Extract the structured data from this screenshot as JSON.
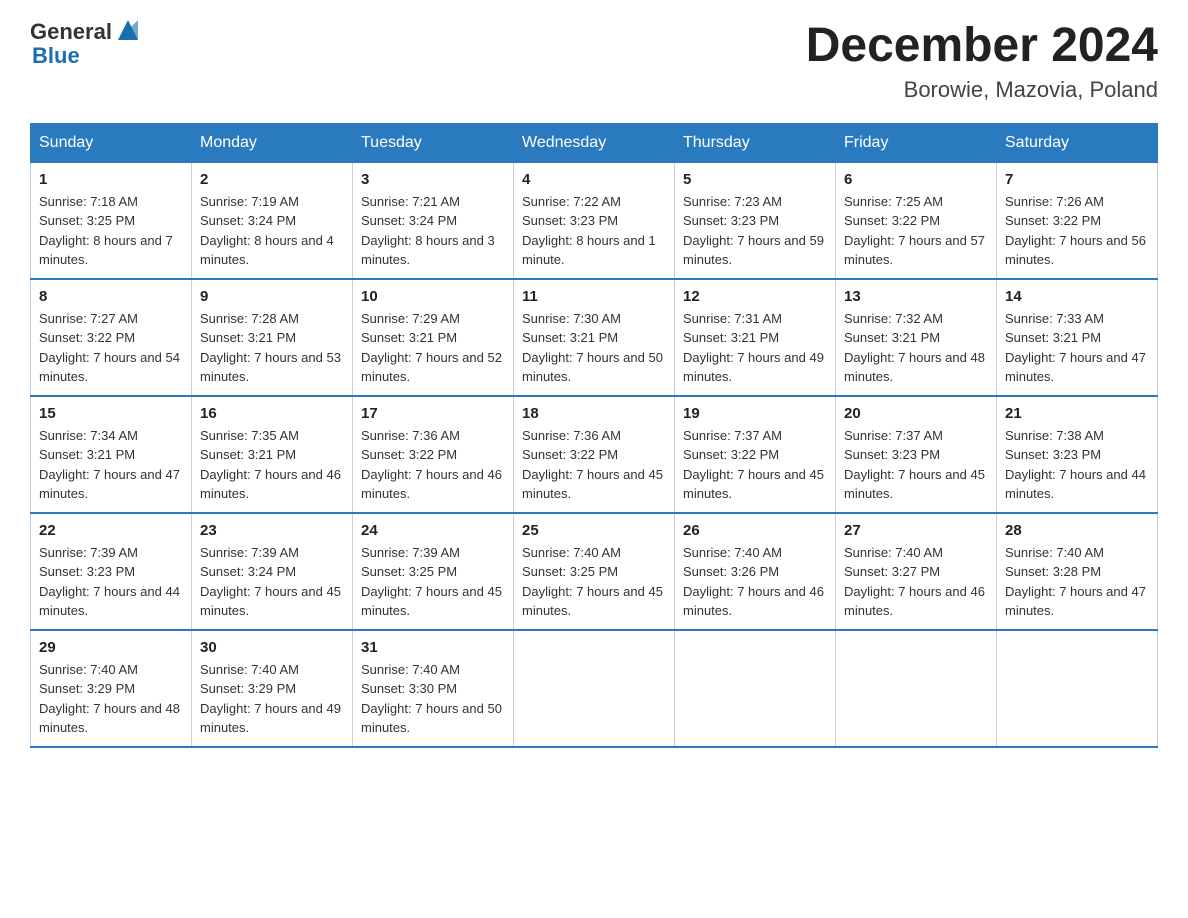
{
  "logo": {
    "text_general": "General",
    "text_blue": "Blue"
  },
  "title": "December 2024",
  "location": "Borowie, Mazovia, Poland",
  "days_of_week": [
    "Sunday",
    "Monday",
    "Tuesday",
    "Wednesday",
    "Thursday",
    "Friday",
    "Saturday"
  ],
  "weeks": [
    [
      {
        "day": "1",
        "sunrise": "7:18 AM",
        "sunset": "3:25 PM",
        "daylight": "8 hours and 7 minutes."
      },
      {
        "day": "2",
        "sunrise": "7:19 AM",
        "sunset": "3:24 PM",
        "daylight": "8 hours and 4 minutes."
      },
      {
        "day": "3",
        "sunrise": "7:21 AM",
        "sunset": "3:24 PM",
        "daylight": "8 hours and 3 minutes."
      },
      {
        "day": "4",
        "sunrise": "7:22 AM",
        "sunset": "3:23 PM",
        "daylight": "8 hours and 1 minute."
      },
      {
        "day": "5",
        "sunrise": "7:23 AM",
        "sunset": "3:23 PM",
        "daylight": "7 hours and 59 minutes."
      },
      {
        "day": "6",
        "sunrise": "7:25 AM",
        "sunset": "3:22 PM",
        "daylight": "7 hours and 57 minutes."
      },
      {
        "day": "7",
        "sunrise": "7:26 AM",
        "sunset": "3:22 PM",
        "daylight": "7 hours and 56 minutes."
      }
    ],
    [
      {
        "day": "8",
        "sunrise": "7:27 AM",
        "sunset": "3:22 PM",
        "daylight": "7 hours and 54 minutes."
      },
      {
        "day": "9",
        "sunrise": "7:28 AM",
        "sunset": "3:21 PM",
        "daylight": "7 hours and 53 minutes."
      },
      {
        "day": "10",
        "sunrise": "7:29 AM",
        "sunset": "3:21 PM",
        "daylight": "7 hours and 52 minutes."
      },
      {
        "day": "11",
        "sunrise": "7:30 AM",
        "sunset": "3:21 PM",
        "daylight": "7 hours and 50 minutes."
      },
      {
        "day": "12",
        "sunrise": "7:31 AM",
        "sunset": "3:21 PM",
        "daylight": "7 hours and 49 minutes."
      },
      {
        "day": "13",
        "sunrise": "7:32 AM",
        "sunset": "3:21 PM",
        "daylight": "7 hours and 48 minutes."
      },
      {
        "day": "14",
        "sunrise": "7:33 AM",
        "sunset": "3:21 PM",
        "daylight": "7 hours and 47 minutes."
      }
    ],
    [
      {
        "day": "15",
        "sunrise": "7:34 AM",
        "sunset": "3:21 PM",
        "daylight": "7 hours and 47 minutes."
      },
      {
        "day": "16",
        "sunrise": "7:35 AM",
        "sunset": "3:21 PM",
        "daylight": "7 hours and 46 minutes."
      },
      {
        "day": "17",
        "sunrise": "7:36 AM",
        "sunset": "3:22 PM",
        "daylight": "7 hours and 46 minutes."
      },
      {
        "day": "18",
        "sunrise": "7:36 AM",
        "sunset": "3:22 PM",
        "daylight": "7 hours and 45 minutes."
      },
      {
        "day": "19",
        "sunrise": "7:37 AM",
        "sunset": "3:22 PM",
        "daylight": "7 hours and 45 minutes."
      },
      {
        "day": "20",
        "sunrise": "7:37 AM",
        "sunset": "3:23 PM",
        "daylight": "7 hours and 45 minutes."
      },
      {
        "day": "21",
        "sunrise": "7:38 AM",
        "sunset": "3:23 PM",
        "daylight": "7 hours and 44 minutes."
      }
    ],
    [
      {
        "day": "22",
        "sunrise": "7:39 AM",
        "sunset": "3:23 PM",
        "daylight": "7 hours and 44 minutes."
      },
      {
        "day": "23",
        "sunrise": "7:39 AM",
        "sunset": "3:24 PM",
        "daylight": "7 hours and 45 minutes."
      },
      {
        "day": "24",
        "sunrise": "7:39 AM",
        "sunset": "3:25 PM",
        "daylight": "7 hours and 45 minutes."
      },
      {
        "day": "25",
        "sunrise": "7:40 AM",
        "sunset": "3:25 PM",
        "daylight": "7 hours and 45 minutes."
      },
      {
        "day": "26",
        "sunrise": "7:40 AM",
        "sunset": "3:26 PM",
        "daylight": "7 hours and 46 minutes."
      },
      {
        "day": "27",
        "sunrise": "7:40 AM",
        "sunset": "3:27 PM",
        "daylight": "7 hours and 46 minutes."
      },
      {
        "day": "28",
        "sunrise": "7:40 AM",
        "sunset": "3:28 PM",
        "daylight": "7 hours and 47 minutes."
      }
    ],
    [
      {
        "day": "29",
        "sunrise": "7:40 AM",
        "sunset": "3:29 PM",
        "daylight": "7 hours and 48 minutes."
      },
      {
        "day": "30",
        "sunrise": "7:40 AM",
        "sunset": "3:29 PM",
        "daylight": "7 hours and 49 minutes."
      },
      {
        "day": "31",
        "sunrise": "7:40 AM",
        "sunset": "3:30 PM",
        "daylight": "7 hours and 50 minutes."
      },
      null,
      null,
      null,
      null
    ]
  ]
}
